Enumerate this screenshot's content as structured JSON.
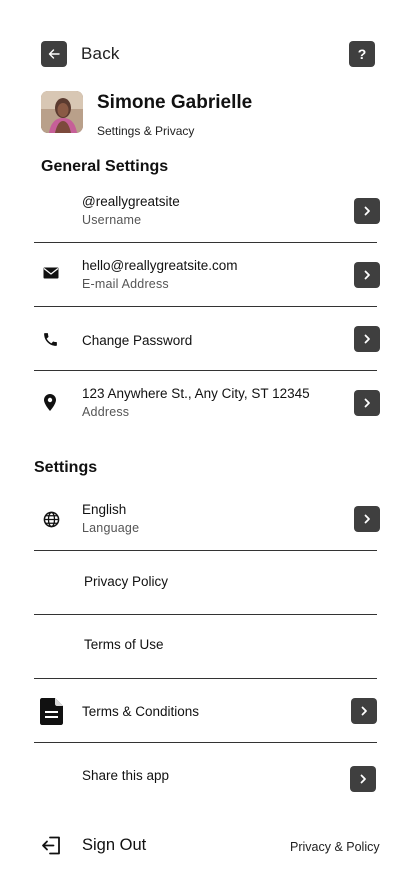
{
  "header": {
    "back_label": "Back",
    "help_label": "?"
  },
  "profile": {
    "name": "Simone Gabrielle",
    "subtitle": "Settings & Privacy"
  },
  "general_settings": {
    "title": "General Settings",
    "items": [
      {
        "primary": "@reallygreatsite",
        "secondary": "Username"
      },
      {
        "primary": "hello@reallygreatsite.com",
        "secondary": "E-mail Address"
      },
      {
        "primary": "Change Password",
        "secondary": ""
      },
      {
        "primary": "123 Anywhere St., Any City, ST 12345",
        "secondary": "Address"
      }
    ]
  },
  "settings": {
    "title": "Settings",
    "items": [
      {
        "primary": "English",
        "secondary": "Language"
      },
      {
        "primary": "Privacy Policy"
      },
      {
        "primary": "Terms of Use"
      },
      {
        "primary": "Terms & Conditions"
      },
      {
        "primary": "Share this app"
      }
    ]
  },
  "footer": {
    "sign_out": "Sign Out",
    "privacy_link": "Privacy & Policy"
  },
  "colors": {
    "button_bg": "#3f3f3f",
    "text": "#111111",
    "muted": "#555555"
  }
}
